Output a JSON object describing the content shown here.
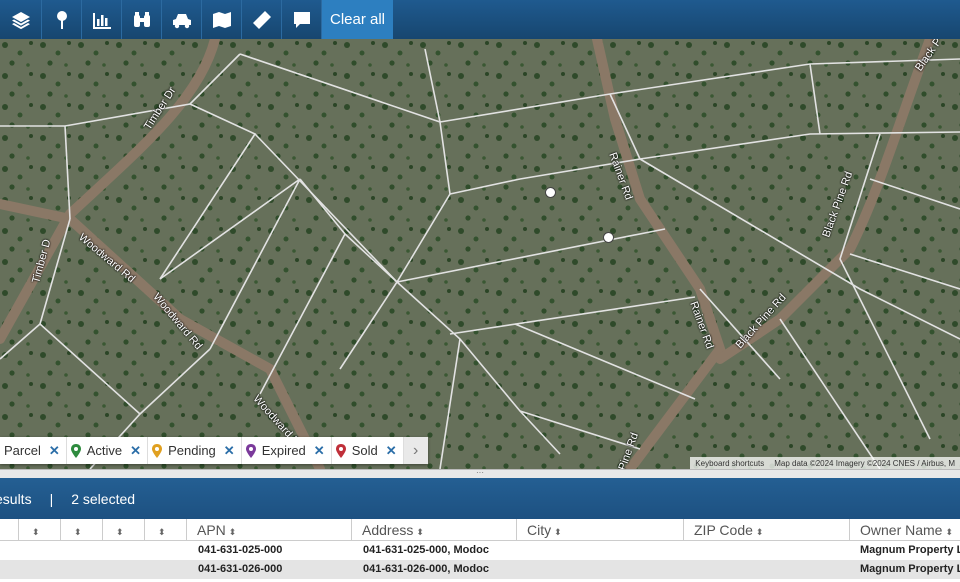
{
  "toolbar": {
    "buttons": [
      {
        "name": "layers-icon"
      },
      {
        "name": "map-pin-icon"
      },
      {
        "name": "chart-icon"
      },
      {
        "name": "binoculars-icon"
      },
      {
        "name": "car-icon"
      },
      {
        "name": "map-icon"
      },
      {
        "name": "ruler-icon"
      },
      {
        "name": "comment-icon"
      }
    ],
    "clear_all": "Clear all"
  },
  "map": {
    "roads": {
      "timber_dr_1": "Timber Dr",
      "timber_dr_2": "Timber D",
      "woodward_rd_1": "Woodward Rd",
      "woodward_rd_2": "Woodward Rd",
      "woodward_rd_3": "Woodward R",
      "rainer_rd_1": "Rainer Rd",
      "rainer_rd_2": "Rainer Rd",
      "black_pine_rd_1": "Black Pine Rd",
      "black_pine_rd_2": "Black Pine Rd",
      "black_p": "Black P",
      "pine_rd": "Pine Rd"
    },
    "legend": [
      {
        "label": "Parcel",
        "color": "#2b6ea8",
        "icon": "parcel"
      },
      {
        "label": "Active",
        "color": "#2e8b3e",
        "icon": "pin"
      },
      {
        "label": "Pending",
        "color": "#e0a020",
        "icon": "pin"
      },
      {
        "label": "Expired",
        "color": "#7b3a9b",
        "icon": "pin"
      },
      {
        "label": "Sold",
        "color": "#c0303a",
        "icon": "pin"
      }
    ],
    "legend_close": "✕",
    "legend_next": "›",
    "attribution": {
      "shortcuts": "Keyboard shortcuts",
      "data": "Map data ©2024 Imagery ©2024 CNES / Airbus, M"
    }
  },
  "divider_handle": "···",
  "results": {
    "count_text": "esults",
    "separator": "|",
    "selected_text": "2 selected"
  },
  "table": {
    "columns": [
      "APN",
      "Address",
      "City",
      "ZIP Code",
      "Owner Name"
    ],
    "sort_glyph": "⬍",
    "rows": [
      {
        "apn": "041-631-025-000",
        "address": "041-631-025-000, Modoc",
        "city": "",
        "zip": "",
        "owner": "Magnum Property Llc"
      },
      {
        "apn": "041-631-026-000",
        "address": "041-631-026-000, Modoc",
        "city": "",
        "zip": "",
        "owner": "Magnum Property Llc"
      }
    ]
  },
  "colors": {
    "toolbar": "#1b4f7f",
    "accent": "#2d7fc0",
    "parcel_line": "#d9d9d9"
  }
}
